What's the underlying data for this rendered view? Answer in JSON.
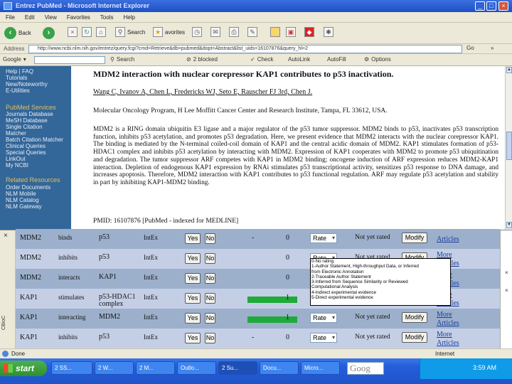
{
  "window": {
    "title": "Entrez PubMed - Microsoft Internet Explorer"
  },
  "menu": [
    "File",
    "Edit",
    "View",
    "Favorites",
    "Tools",
    "Help"
  ],
  "toolbar": {
    "back": "Back",
    "search": "Search",
    "favorites": "avorites"
  },
  "address": {
    "label": "Address",
    "url": "http://www.ncbi.nlm.nih.gov/entrez/query.fcgi?cmd=Retrieve&db=pubmed&dopt=Abstract&list_uids=16107876&query_hl=2",
    "go": "Go",
    "links": "»"
  },
  "googlebar": {
    "brand": "Google",
    "search": "Search",
    "blocked": "2 blocked",
    "check": "Check",
    "autolink": "AutoLink",
    "autofill": "AutoFill",
    "options": "Options"
  },
  "sidebar": {
    "items": [
      "Help | FAQ",
      "Tutorials",
      "New/Noteworthy",
      "E-Utilities"
    ],
    "services_head": "PubMed Services",
    "services": [
      "Journals Database",
      "MeSH Database",
      "Single Citation",
      "Matcher",
      "Batch Citation Matcher",
      "Clinical Queries",
      "Special Queries",
      "LinkOut",
      "My NCBI"
    ],
    "related_head": "Related Resources",
    "related": [
      "Order Documents",
      "NLM Mobile",
      "NLM Catalog",
      "NLM Gateway"
    ]
  },
  "article": {
    "title": "MDM2 interaction with nuclear corepressor KAP1 contributes to p53 inactivation.",
    "authors": "Wang C, Ivanov A, Chen L, Fredericks WJ, Seto E, Rauscher FJ 3rd, Chen J.",
    "affiliation": "Molecular Oncology Program, H Lee Moffitt Cancer Center and Research Institute, Tampa, FL 33612, USA.",
    "abstract": "MDM2 is a RING domain ubiquitin E3 ligase and a major regulator of the p53 tumor suppressor. MDM2 binds to p53, inactivates p53 transcription function, inhibits p53 acetylation, and promotes p53 degradation. Here, we present evidence that MDM2 interacts with the nuclear corepressor KAP1. The binding is mediated by the N-terminal coiled-coil domain of KAP1 and the central acidic domain of MDM2. KAP1 stimulates formation of p53-HDAC1 complex and inhibits p53 acetylation by interacting with MDM2. Expression of KAP1 cooperates with MDM2 to promote p53 ubiquitination and degradation. The tumor suppressor ARF competes with KAP1 in MDM2 binding; oncogene induction of ARF expression reduces MDM2-KAP1 interaction. Depletion of endogenous KAP1 expression by RNAi stimulates p53 transcriptional activity, sensitizes p53 response to DNA damage, and increases apoptosis. Therefore, MDM2 interaction with KAP1 contributes to p53 functional regulation. ARF may regulate p53 acetylation and stability in part by inhibiting KAP1-MDM2 binding.",
    "pmid": "PMID: 16107876 [PubMed - indexed for MEDLINE]"
  },
  "table": {
    "rows": [
      {
        "a": "MDM2",
        "rel": "binds",
        "b": "p53",
        "src": "IntEx",
        "yes": "Yes",
        "no": "No",
        "score": "-",
        "count": "0",
        "rate": "Rate",
        "status": "Not yet rated",
        "modify": "Modify",
        "more": "Articles",
        "bar": 0
      },
      {
        "a": "MDM2",
        "rel": "inhibits",
        "b": "p53",
        "src": "IntEx",
        "yes": "Yes",
        "no": "No",
        "score": "",
        "count": "0",
        "rate": "Rate",
        "status": "Not yet rated",
        "modify": "Modify",
        "more": "More Articles",
        "bar": 0
      },
      {
        "a": "MDM2",
        "rel": "interacts",
        "b": "KAP1",
        "src": "IntEx",
        "yes": "Yes",
        "no": "No",
        "score": "",
        "count": "0",
        "rate": "",
        "status": "",
        "modify": "",
        "more": "More Articles",
        "bar": 0
      },
      {
        "a": "KAP1",
        "rel": "stimulates",
        "b": "p53-HDAC1 complex",
        "src": "IntEx",
        "yes": "Yes",
        "no": "No",
        "score": "",
        "count": "1",
        "rate": "",
        "status": "",
        "modify": "",
        "more": "More Articles",
        "bar": 1
      },
      {
        "a": "KAP1",
        "rel": "interacting",
        "b": "MDM2",
        "src": "IntEx",
        "yes": "Yes",
        "no": "No",
        "score": "",
        "count": "1",
        "rate": "Rate",
        "status": "Not yet rated",
        "modify": "Modify",
        "more": "More Articles",
        "bar": 1
      },
      {
        "a": "KAP1",
        "rel": "inhibits",
        "b": "p53",
        "src": "IntEx",
        "yes": "Yes",
        "no": "No",
        "score": "-",
        "count": "0",
        "rate": "Rate",
        "status": "Not yet rated",
        "modify": "Modify",
        "more": "More Articles",
        "bar": 0
      }
    ],
    "rate_options": [
      "0-No rating",
      "1-Author Statement, High-throughput Data, or Inferred",
      "from Electronic Annotation",
      "2-Traceable Author Statement",
      "3-Inferred from Sequence Similarity or Reviewed",
      "Computational Analysis",
      "4-Indirect experimental evidence",
      "5-Direct experimental evidence"
    ],
    "side_label": "CBioC"
  },
  "statusbar": {
    "done": "Done",
    "zone": "Internet"
  },
  "taskbar": {
    "start": "start",
    "tasks": [
      "2 SS...",
      "2 W...",
      "2 M...",
      "Outlo...",
      "2 Su...",
      "Docu...",
      "Micro..."
    ],
    "google": "Goog",
    "clock": "3:59 AM"
  },
  "colors": {
    "sidebar": "#336699",
    "row_dark": "#9cb0cc",
    "row_light": "#c4cfe6",
    "bar": "#1faa3a",
    "link": "#1a3c9c"
  }
}
